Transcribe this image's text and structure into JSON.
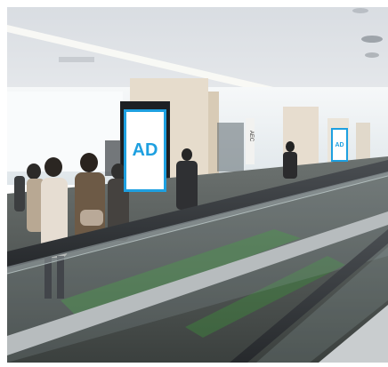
{
  "photo": {
    "subject": "airport-moving-walkway",
    "ads": [
      {
        "text": "AD"
      },
      {
        "text": "AD"
      }
    ],
    "pillar_sign": "AEC",
    "colors": {
      "ad_border": "#1ea0e0",
      "ad_text": "#1ea0e0",
      "floor_green": "#3f8a3c",
      "ceiling": "#e8eaed"
    }
  }
}
